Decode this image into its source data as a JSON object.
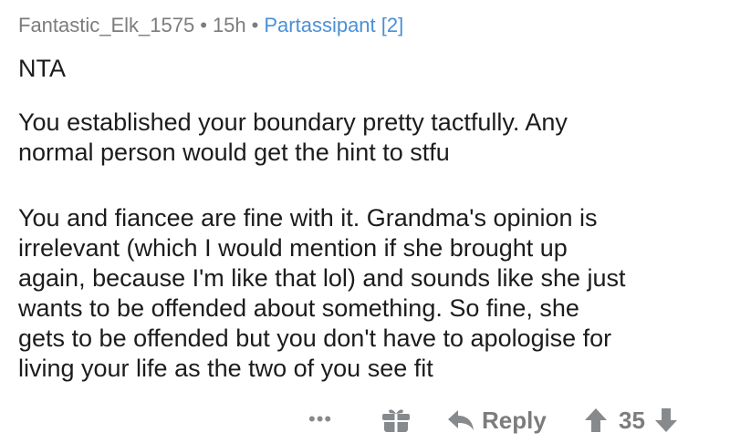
{
  "comment": {
    "author": "Fantastic_Elk_1575",
    "separator": "•",
    "age": "15h",
    "flair": "Partassipant [2]",
    "paragraphs": [
      "NTA",
      "You established your boundary pretty tactfully. Any\nnormal person would get the hint to stfu",
      "You and fiancee are fine with it. Grandma's opinion is\nirrelevant (which I would mention if she brought up\nagain, because I'm like that lol) and sounds like she just\nwants to be offended about something. So fine, she\ngets to be offended but you don't have to apologise for\nliving your life as the two of you see fit"
    ]
  },
  "actions": {
    "more": "•••",
    "reply_label": "Reply",
    "score": "35",
    "icons": {
      "more": "more-options-icon",
      "award": "gift-award-icon",
      "reply": "reply-arrow-icon",
      "upvote": "upvote-arrow-icon",
      "downvote": "downvote-arrow-icon"
    },
    "icon_color": "#878a8c"
  },
  "colors": {
    "text": "#1c1c1c",
    "meta": "#7c7c7c",
    "flair": "#4a90d6"
  }
}
